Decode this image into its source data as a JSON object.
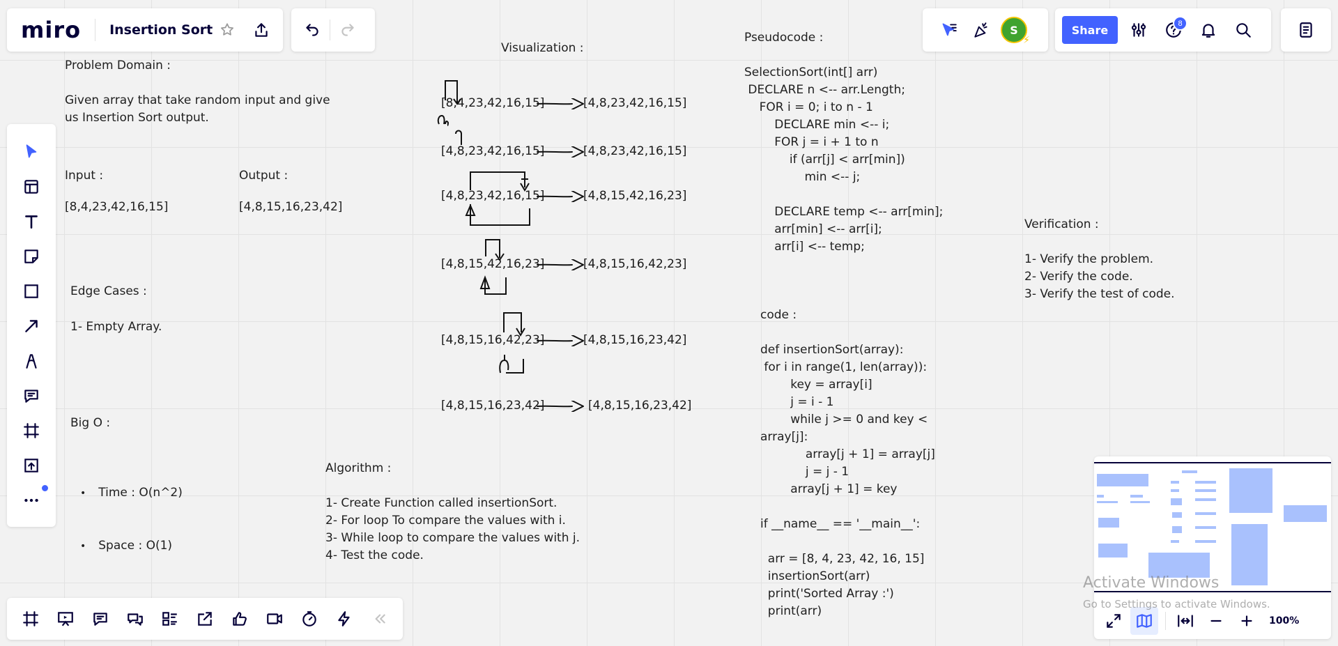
{
  "topbar": {
    "logo": "miro",
    "board_title": "Insertion Sort",
    "star_icon": "star-icon",
    "export_icon": "upload-icon",
    "undo_icon": "undo-icon",
    "redo_icon": "redo-icon",
    "avatar_initial": "S",
    "share_label": "Share",
    "help_badge": "8",
    "accent": "#4262ff"
  },
  "board": {
    "problem_domain": {
      "title": "Problem Domain :",
      "body_1": "Given array that take random input and give",
      "body_2": "us Insertion Sort output."
    },
    "input": {
      "title": "Input :",
      "value": "[8,4,23,42,16,15]"
    },
    "output": {
      "title": "Output :",
      "value": "[4,8,15,16,23,42]"
    },
    "edge_cases": {
      "title": "Edge Cases :",
      "item_1": "1- Empty Array."
    },
    "big_o": {
      "title": "Big O :",
      "time": "Time : O(n^2)",
      "space": "Space : O(1)"
    },
    "algorithm": {
      "title": "Algorithm :",
      "steps": [
        "1- Create Function called insertionSort.",
        "2- For loop To compare the values with i.",
        "3- While loop to compare the values with j.",
        "4- Test the code."
      ]
    },
    "visualization": {
      "title": "Visualization :",
      "rows": [
        {
          "before": "[8,4,23,42,16,15]",
          "after": "[4,8,23,42,16,15]"
        },
        {
          "before": "[4,8,23,42,16,15]",
          "after": "[4,8,23,42,16,15]"
        },
        {
          "before": "[4,8,23,42,16,15]",
          "after": "[4,8,15,42,16,23]"
        },
        {
          "before": "[4,8,15,42,16,23]",
          "after": "[4,8,15,16,42,23]"
        },
        {
          "before": "[4,8,15,16,42,23]",
          "after": "[4,8,15,16,23,42]"
        },
        {
          "before": "[4,8,15,16,23,42]",
          "after": "[4,8,15,16,23,42]"
        }
      ]
    },
    "pseudocode": {
      "title": "Pseudocode :",
      "lines": [
        "SelectionSort(int[] arr)",
        " DECLARE n <-- arr.Length;",
        "    FOR i = 0; i to n - 1",
        "        DECLARE min <-- i;",
        "        FOR j = i + 1 to n",
        "            if (arr[j] < arr[min])",
        "                min <-- j;",
        "",
        "        DECLARE temp <-- arr[min];",
        "        arr[min] <-- arr[i];",
        "        arr[i] <-- temp;"
      ]
    },
    "code": {
      "title": "code :",
      "lines": [
        "def insertionSort(array):",
        " for i in range(1, len(array)):",
        "        key = array[i]",
        "        j = i - 1",
        "        while j >= 0 and key <",
        "array[j]:",
        "            array[j + 1] = array[j]",
        "            j = j - 1",
        "        array[j + 1] = key",
        "",
        "if __name__ == '__main__':",
        "",
        "  arr = [8, 4, 23, 42, 16, 15]",
        "  insertionSort(arr)",
        "  print('Sorted Array :')",
        "  print(arr)"
      ]
    },
    "verification": {
      "title": "Verification :",
      "items": [
        "1- Verify the problem.",
        "2- Verify the code.",
        "3- Verify the test of code."
      ]
    }
  },
  "watermark": {
    "title": "Activate Windows",
    "subtitle": "Go to Settings to activate Windows."
  },
  "zoom": {
    "level": "100%"
  }
}
